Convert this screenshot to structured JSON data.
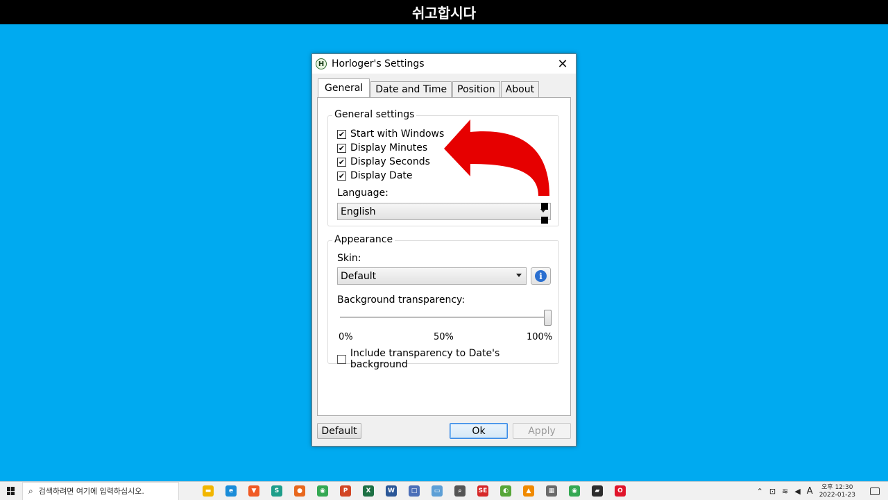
{
  "banner": {
    "text": "쉬고합시다"
  },
  "window": {
    "title": "Horloger's Settings",
    "icon_letter": "H",
    "close_glyph": "✕"
  },
  "tabs": [
    {
      "label": "General",
      "active": true
    },
    {
      "label": "Date and Time",
      "active": false
    },
    {
      "label": "Position",
      "active": false
    },
    {
      "label": "About",
      "active": false
    }
  ],
  "general_settings": {
    "group_title": "General settings",
    "checks": [
      {
        "label": "Start with Windows",
        "checked": true
      },
      {
        "label": "Display Minutes",
        "checked": true
      },
      {
        "label": "Display Seconds",
        "checked": true
      },
      {
        "label": "Display Date",
        "checked": true
      }
    ],
    "language_label": "Language:",
    "language_value": "English"
  },
  "appearance": {
    "group_title": "Appearance",
    "skin_label": "Skin:",
    "skin_value": "Default",
    "transparency_label": "Background transparency:",
    "transparency_value_percent": 100,
    "ticks": [
      "0%",
      "50%",
      "100%"
    ],
    "include_transparency_label": "Include transparency to Date's background",
    "include_transparency_checked": false
  },
  "buttons": {
    "default": "Default",
    "ok": "Ok",
    "apply": "Apply"
  },
  "annotation": {
    "arrow_color": "#e60000"
  },
  "taskbar": {
    "search_placeholder": "검색하려면 여기에 입력하십시오.",
    "clock_period_time": "오후 12:30",
    "clock_date": "2022-01-23",
    "ime_indicator": "A",
    "apps": [
      {
        "name": "file-explorer-icon",
        "color": "#f2b600",
        "glyph": "▬"
      },
      {
        "name": "edge-icon",
        "color": "#1a8cd8",
        "glyph": "e"
      },
      {
        "name": "brave-icon",
        "color": "#f05a24",
        "glyph": "▼"
      },
      {
        "name": "app-s-icon",
        "color": "#1e9e8a",
        "glyph": "S"
      },
      {
        "name": "firefox-icon",
        "color": "#e8681e",
        "glyph": "●"
      },
      {
        "name": "chrome-icon",
        "color": "#34a853",
        "glyph": "◉"
      },
      {
        "name": "powerpoint-icon",
        "color": "#d24726",
        "glyph": "P"
      },
      {
        "name": "excel-icon",
        "color": "#1d7044",
        "glyph": "X"
      },
      {
        "name": "word-icon",
        "color": "#2b5797",
        "glyph": "W"
      },
      {
        "name": "calculator-app-icon",
        "color": "#4b6fb8",
        "glyph": "□"
      },
      {
        "name": "remote-desktop-icon",
        "color": "#5d9fd6",
        "glyph": "▭"
      },
      {
        "name": "magnifier-icon",
        "color": "#555555",
        "glyph": "⌕"
      },
      {
        "name": "app-se-icon",
        "color": "#d62828",
        "glyph": "SE"
      },
      {
        "name": "app-green-icon",
        "color": "#57a639",
        "glyph": "◐"
      },
      {
        "name": "vlc-icon",
        "color": "#f08a00",
        "glyph": "▲"
      },
      {
        "name": "calculator-icon",
        "color": "#6a6a6a",
        "glyph": "▦"
      },
      {
        "name": "chrome-alt-icon",
        "color": "#34a853",
        "glyph": "◉"
      },
      {
        "name": "sticky-notes-icon",
        "color": "#2d2d2d",
        "glyph": "▰"
      },
      {
        "name": "opera-icon",
        "color": "#e0152b",
        "glyph": "O"
      }
    ]
  }
}
